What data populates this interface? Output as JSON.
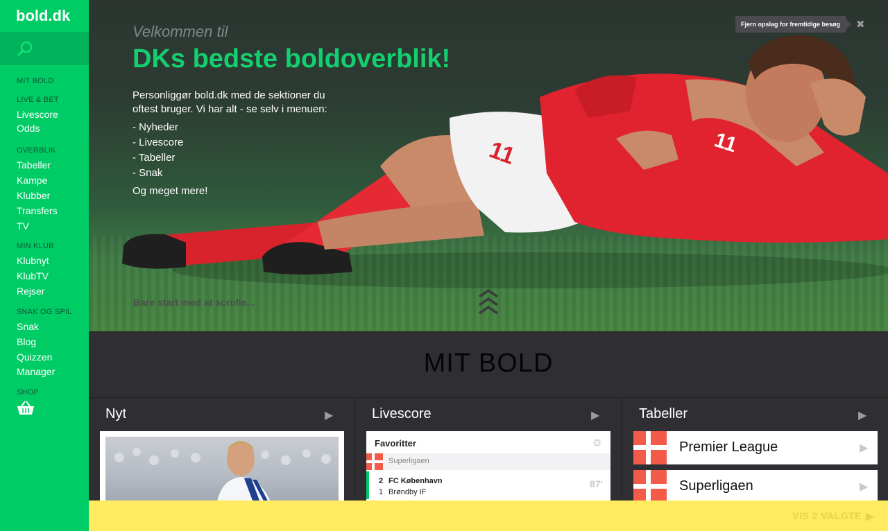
{
  "sidebar": {
    "logo": "bold.dk",
    "sections": [
      {
        "head": "MIT BOLD",
        "items": []
      },
      {
        "head": "LIVE & BET",
        "items": [
          "Livescore",
          "Odds"
        ]
      },
      {
        "head": "OVERBLIK",
        "items": [
          "Tabeller",
          "Kampe",
          "Klubber",
          "Transfers",
          "TV"
        ]
      },
      {
        "head": "MIN KLUB",
        "items": [
          "Klubnyt",
          "KlubTV",
          "Rejser"
        ]
      },
      {
        "head": "SNAK OG SPIL",
        "items": [
          "Snak",
          "Blog",
          "Quizzen",
          "Manager"
        ]
      },
      {
        "head": "SHOP",
        "items": []
      }
    ]
  },
  "hero": {
    "welcome": "Velkommen til",
    "title": "DKs bedste boldoverblik!",
    "intro": "Personliggør bold.dk med de sektioner du oftest bruger. Vi har alt - se selv i menuen:",
    "list": [
      "- Nyheder",
      "- Livescore",
      "- Tabeller",
      "- Snak"
    ],
    "more": "Og meget mere!",
    "scroll_hint": "Bare start med at scrolle...",
    "dismiss_label": "Fjern opslag for fremtidige besøg",
    "player_number": "11"
  },
  "section_title": "MIT BOLD",
  "columns": {
    "nyt": {
      "title": "Nyt"
    },
    "livescore": {
      "title": "Livescore",
      "favorites": "Favoritter",
      "league": "Superligaen",
      "match": {
        "home_score": "2",
        "home_team": "FC København",
        "away_score": "1",
        "away_team": "Brøndby IF",
        "minute": "87'"
      }
    },
    "tabeller": {
      "title": "Tabeller",
      "leagues": [
        "Premier League",
        "Superligaen"
      ]
    }
  },
  "bottom_bar": {
    "label": "VIS 2 VALGTE"
  },
  "colors": {
    "brand_green": "#00cc66",
    "accent_yellow": "#ffeb5f",
    "danish_red": "#f25b4a"
  }
}
